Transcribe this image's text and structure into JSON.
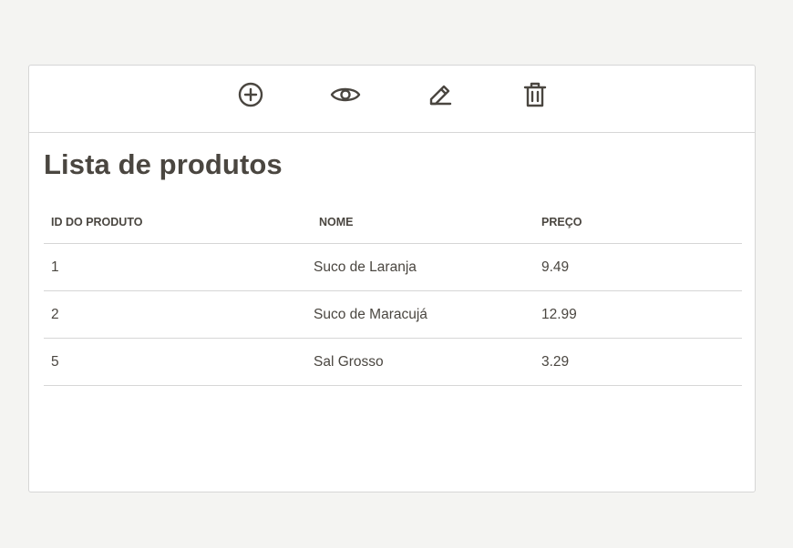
{
  "toolbar": {
    "icons": [
      "add-circle-icon",
      "eye-icon",
      "pencil-icon",
      "trash-icon"
    ]
  },
  "page": {
    "title": "Lista de produtos"
  },
  "table": {
    "headers": {
      "id": "ID DO PRODUTO",
      "nome": "NOME",
      "preco": "PREÇO"
    },
    "rows": [
      {
        "id": "1",
        "nome": "Suco de Laranja",
        "preco": "9.49"
      },
      {
        "id": "2",
        "nome": "Suco de Maracujá",
        "preco": "12.99"
      },
      {
        "id": "5",
        "nome": "Sal Grosso",
        "preco": "3.29"
      }
    ]
  },
  "colors": {
    "background": "#f4f4f2",
    "card": "#ffffff",
    "text": "#4a4640",
    "border": "#d6d6d6"
  }
}
